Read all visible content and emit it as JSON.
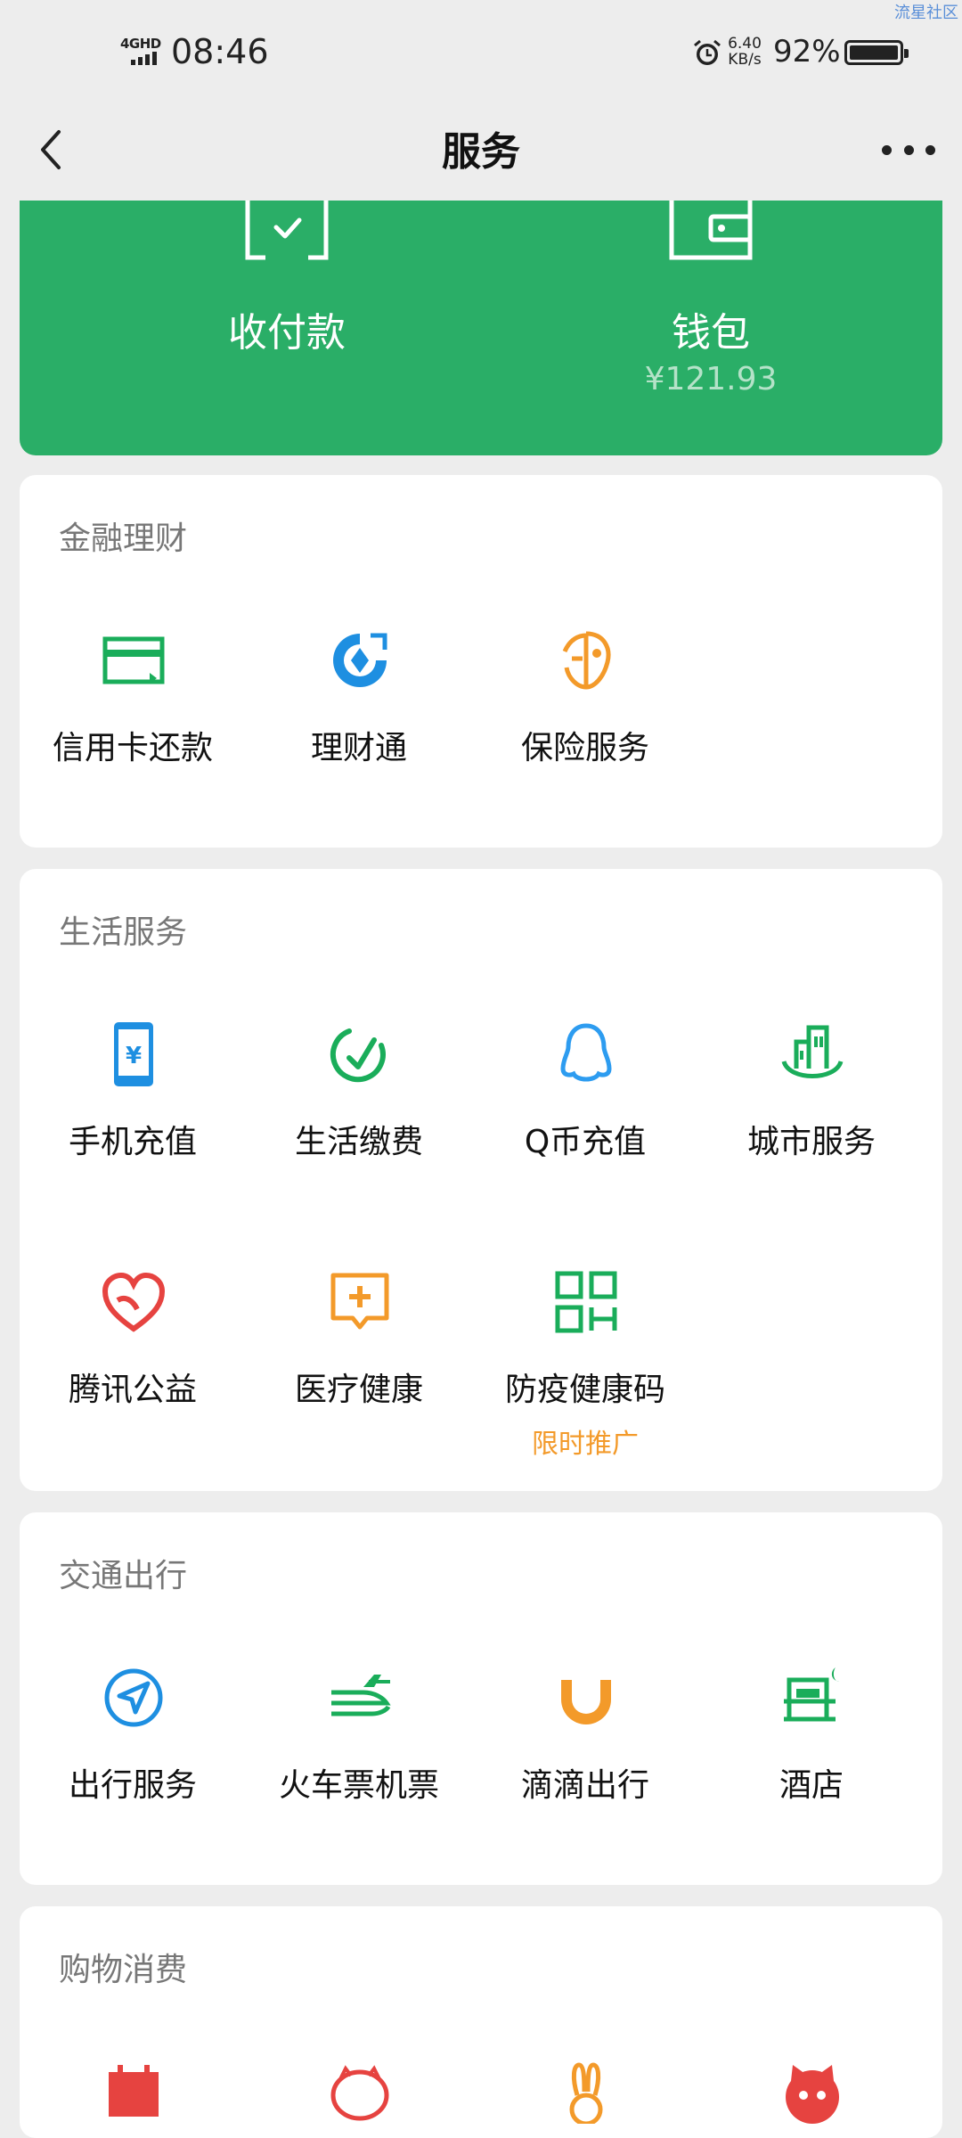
{
  "watermark": "流星社区",
  "status_bar": {
    "network": "4GHD",
    "time": "08:46",
    "speed_value": "6.40",
    "speed_unit": "KB/s",
    "battery": "92%"
  },
  "nav": {
    "title": "服务"
  },
  "top_card": {
    "pay_label": "收付款",
    "wallet_label": "钱包",
    "wallet_amount": "¥121.93",
    "color": "#2aae67"
  },
  "sections": [
    {
      "title": "金融理财",
      "items": [
        {
          "label": "信用卡还款",
          "icon": "credit-card-icon",
          "color": "#1aad5a"
        },
        {
          "label": "理财通",
          "icon": "licaitong-icon",
          "color": "#1e8fe1"
        },
        {
          "label": "保险服务",
          "icon": "insurance-icon",
          "color": "#f39a2a"
        }
      ]
    },
    {
      "title": "生活服务",
      "items": [
        {
          "label": "手机充值",
          "icon": "phone-recharge-icon",
          "color": "#1e8fe1"
        },
        {
          "label": "生活缴费",
          "icon": "bill-payment-icon",
          "color": "#1aad5a"
        },
        {
          "label": "Q币充值",
          "icon": "qq-penguin-icon",
          "color": "#2d9cf0"
        },
        {
          "label": "城市服务",
          "icon": "city-buildings-icon",
          "color": "#1aad5a"
        },
        {
          "label": "腾讯公益",
          "icon": "charity-heart-icon",
          "color": "#e64340"
        },
        {
          "label": "医疗健康",
          "icon": "medical-icon",
          "color": "#f39a2a"
        },
        {
          "label": "防疫健康码",
          "icon": "qr-code-icon",
          "color": "#1aad5a",
          "sub": "限时推广"
        }
      ]
    },
    {
      "title": "交通出行",
      "items": [
        {
          "label": "出行服务",
          "icon": "navigation-icon",
          "color": "#1e8fe1"
        },
        {
          "label": "火车票机票",
          "icon": "train-plane-icon",
          "color": "#1aad5a"
        },
        {
          "label": "滴滴出行",
          "icon": "didi-icon",
          "color": "#f39a2a"
        },
        {
          "label": "酒店",
          "icon": "hotel-bed-icon",
          "color": "#1aad5a"
        }
      ]
    },
    {
      "title": "购物消费",
      "items": [
        {
          "label": "",
          "icon": "calendar-icon",
          "color": "#e64340"
        },
        {
          "label": "",
          "icon": "pig-icon",
          "color": "#e64340"
        },
        {
          "label": "",
          "icon": "rabbit-icon",
          "color": "#f39a2a"
        },
        {
          "label": "",
          "icon": "cat-icon",
          "color": "#e64340"
        }
      ]
    }
  ]
}
